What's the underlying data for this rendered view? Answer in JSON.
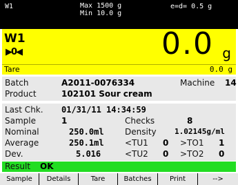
{
  "top": {
    "scale_label": "W1",
    "max": "Max 1500 g",
    "min": "Min 10.0 g",
    "e_d": "e=d= 0.5 g"
  },
  "weighing": {
    "scale_id": "W1",
    "zero_indicator": "▶0◀",
    "value": "0.0",
    "unit": "g",
    "tare_label": "Tare",
    "tare_value": "0.0 g"
  },
  "batch_panel": {
    "batch_label": "Batch",
    "batch_value": "A2011-0076334",
    "machine_label": "Machine",
    "machine_value": "14",
    "product_label": "Product",
    "product_value": "102101 Sour cream"
  },
  "check_panel": {
    "last_chk_label": "Last Chk.",
    "last_chk_value": "01/31/11 14:34:59",
    "sample_label": "Sample",
    "sample_value": "1",
    "checks_label": "Checks",
    "checks_value": "8",
    "nominal_label": "Nominal",
    "nominal_value": "250.0ml",
    "density_label": "Density",
    "density_value": "1.02145g/ml",
    "average_label": "Average",
    "average_value": "250.1ml",
    "tu1_label": "<TU1",
    "tu1_value": "0",
    "to1_label": ">TO1",
    "to1_value": "1",
    "dev_label": "Dev.",
    "dev_value": "5.016",
    "tu2_label": "<TU2",
    "tu2_value": "0",
    "to2_label": ">TO2",
    "to2_value": "0"
  },
  "result": {
    "label": "Result",
    "value": "OK"
  },
  "softkeys": [
    "Sample",
    "Details",
    "Tare",
    "Batches",
    "Print",
    "-->"
  ],
  "colors": {
    "weighing_bg": "#ffff00",
    "panel_bg": "#e8e8e8",
    "result_bg": "#22dd22",
    "topbar_bg": "#000000"
  }
}
